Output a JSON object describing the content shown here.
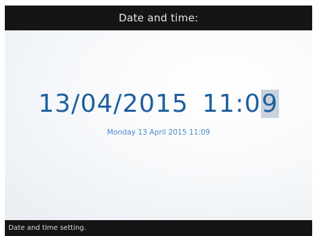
{
  "header": {
    "title": "Date and time:"
  },
  "main": {
    "date": "13/04/2015",
    "time_prefix": "11:0",
    "time_selected_digit": "9",
    "long_datetime": "Monday 13 April 2015 11:09"
  },
  "footer": {
    "hint": "Date and time setting."
  },
  "colors": {
    "header_bg": "#151515",
    "accent_blue": "#1f5f9e",
    "sub_blue": "#4f86c6",
    "selection": "#c9d3de"
  }
}
